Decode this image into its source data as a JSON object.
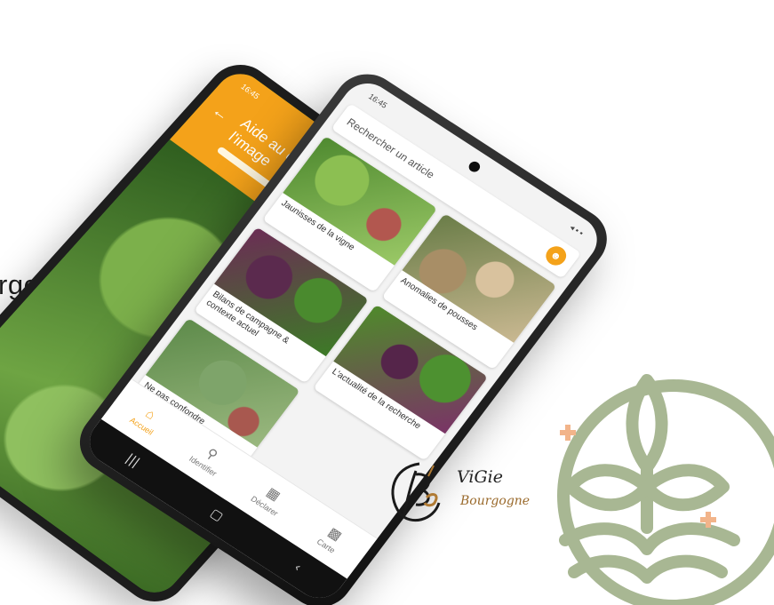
{
  "background_text": "rgogne",
  "back_phone": {
    "status_time": "16:45",
    "status_right": "◂ ▪ ▪",
    "title": "Aide au diagnostic par l'image",
    "progress": 0.85,
    "back_icon": "arrow-left-icon",
    "close_icon": "close-icon"
  },
  "front_phone": {
    "status_time": "16:45",
    "status_right": "◂ ▪ ▪",
    "search_placeholder": "Rechercher un article",
    "account_icon": "account-icon",
    "articles": [
      {
        "label": "Jaunisses de la vigne"
      },
      {
        "label": "Anomalies de pousses"
      },
      {
        "label": "Bilans de campagne & contexte actuel"
      },
      {
        "label": "L'actualité de la recherche"
      },
      {
        "label": "Ne pas confondre"
      }
    ],
    "nav": [
      {
        "label": "Accueil",
        "icon": "home-icon",
        "active": true
      },
      {
        "label": "Identifier",
        "icon": "search-icon",
        "active": false
      },
      {
        "label": "Déclarer",
        "icon": "declare-icon",
        "active": false
      },
      {
        "label": "Carte",
        "icon": "map-icon",
        "active": false
      }
    ],
    "system_nav": [
      "|||",
      "▢",
      "‹"
    ]
  },
  "vigie_logo": {
    "name": "ViGie",
    "subtitle": "Bourgogne"
  },
  "colors": {
    "accent": "#f4a21a",
    "plant_logo": "#a8b793",
    "plant_logo_cross": "#f2b48a"
  }
}
